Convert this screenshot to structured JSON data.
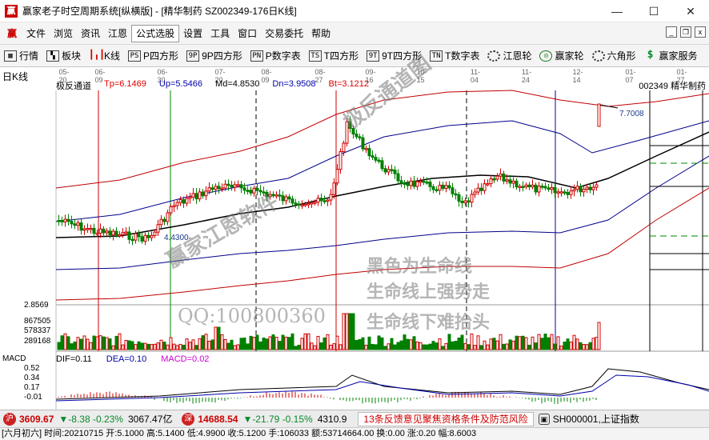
{
  "window": {
    "title": "赢家老子时空周期系统[纵横版] - [精华制药  SZ002349-176日K线]",
    "minimize": "—",
    "maximize": "☐",
    "close": "✕"
  },
  "menu": {
    "logo": "赢",
    "items": [
      "文件",
      "浏览",
      "资讯",
      "江恩",
      "公式选股",
      "设置",
      "工具",
      "窗口",
      "交易委托",
      "帮助"
    ]
  },
  "toolbar": {
    "items": [
      {
        "label": "行情",
        "icon": "grid-icon"
      },
      {
        "label": "板块",
        "icon": "blocks-icon"
      },
      {
        "label": "K线",
        "icon": "candlestick-icon"
      },
      {
        "label": "P四方形",
        "icon": "ps-icon"
      },
      {
        "label": "9P四方形",
        "icon": "9p-icon"
      },
      {
        "label": "P数字表",
        "icon": "pn-icon"
      },
      {
        "label": "T四方形",
        "icon": "ts-icon"
      },
      {
        "label": "9T四方形",
        "icon": "9t-icon"
      },
      {
        "label": "T数字表",
        "icon": "tn-icon"
      },
      {
        "label": "江恩轮",
        "icon": "gann-wheel-icon"
      },
      {
        "label": "赢家轮",
        "icon": "winner-wheel-icon"
      },
      {
        "label": "六角形",
        "icon": "hexagon-icon"
      },
      {
        "label": "赢家服务",
        "icon": "dollar-icon"
      }
    ]
  },
  "chart": {
    "period": "日K线",
    "dates": [
      "05-20",
      "06-09",
      "06-30",
      "07-20",
      "08-09",
      "08-27",
      "09-16",
      "10-15",
      "11-04",
      "11-24",
      "12-14",
      "01-07",
      "01-27"
    ],
    "indicator": {
      "name": "极反通道",
      "tp": "Tp=6.1469",
      "up": "Up=5.5466",
      "md": "Md=4.8530",
      "dn": "Dn=3.9508",
      "bt": "Bt=3.1212"
    },
    "stock_id": "002349  精华制药",
    "price_high_label": "7.7008",
    "price_low_label": "4.4300",
    "axis_price": "2.8569",
    "volume_axis": [
      "867505",
      "578337",
      "289168"
    ],
    "macd": {
      "title": "MACD",
      "dif": "DIF=0.11",
      "dea": "DEA=0.10",
      "macd": "MACD=0.02",
      "axis": [
        "0.52",
        "0.34",
        "0.17",
        "-0.01"
      ]
    },
    "watermarks": {
      "diag1": "极反通道图",
      "diag2": "赢家江恩软件",
      "line1": "黑色为生命线",
      "line2": "生命线上强势走",
      "line3": "生命线下难抬头",
      "qq": "QQ:100800360"
    },
    "colors": {
      "up": "#d00000",
      "down": "#008000",
      "life": "#000000",
      "channel": "#00008b",
      "outer": "#c00000"
    }
  },
  "status": {
    "sh_value": "3609.67",
    "sh_change": "▼-8.38  -0.23%",
    "sh_amount": "3067.47亿",
    "sz_value": "14688.54",
    "sz_change": "▼-21.79  -0.15%",
    "sz_amount": "4310.9",
    "news": "13条反馈意见聚焦资格条件及防范风险",
    "index_label": "SH000001,上证指数"
  },
  "info": {
    "text": "[六月初六] 时间:20210715 开:5.1000 高:5.1400 低:4.9900 收:5.1200 手:106033 额:53714664.00 换:0.00 涨:0.20 幅:8.6003"
  }
}
